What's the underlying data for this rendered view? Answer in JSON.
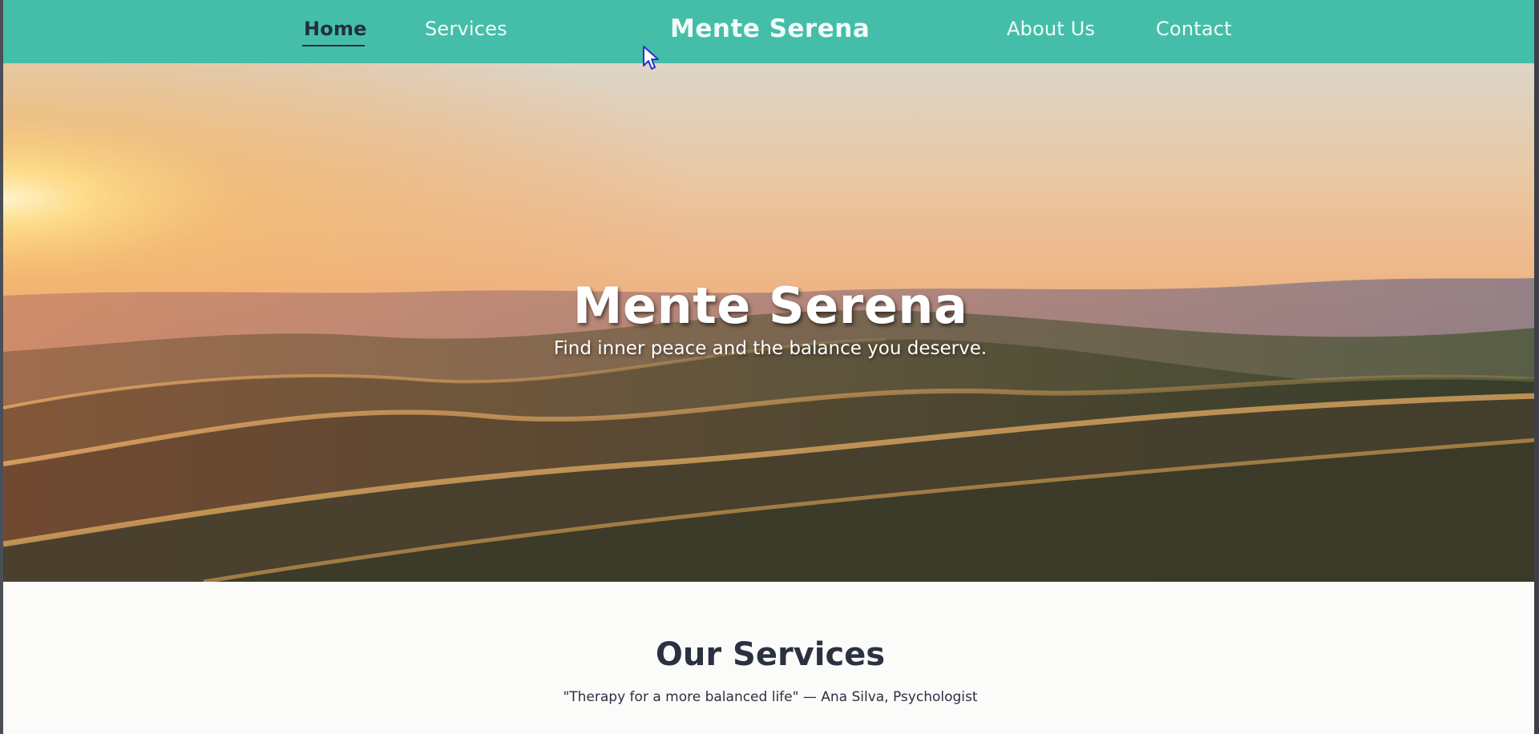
{
  "nav": {
    "links": [
      {
        "label": "Home",
        "active": true
      },
      {
        "label": "Services",
        "active": false
      },
      {
        "label": "About Us",
        "active": false
      },
      {
        "label": "Contact",
        "active": false
      }
    ],
    "brand": "Mente Serena",
    "background_color": "#45bea9",
    "active_color": "#24303a"
  },
  "hero": {
    "title": "Mente Serena",
    "subtitle": "Find inner peace and the balance you deserve.",
    "image": "sunset-rolling-hills"
  },
  "services": {
    "title": "Our Services",
    "quote": "\"Therapy for a more balanced life\" — Ana Silva, Psychologist"
  },
  "icons": {
    "cursor": "arrow-cursor-icon"
  }
}
